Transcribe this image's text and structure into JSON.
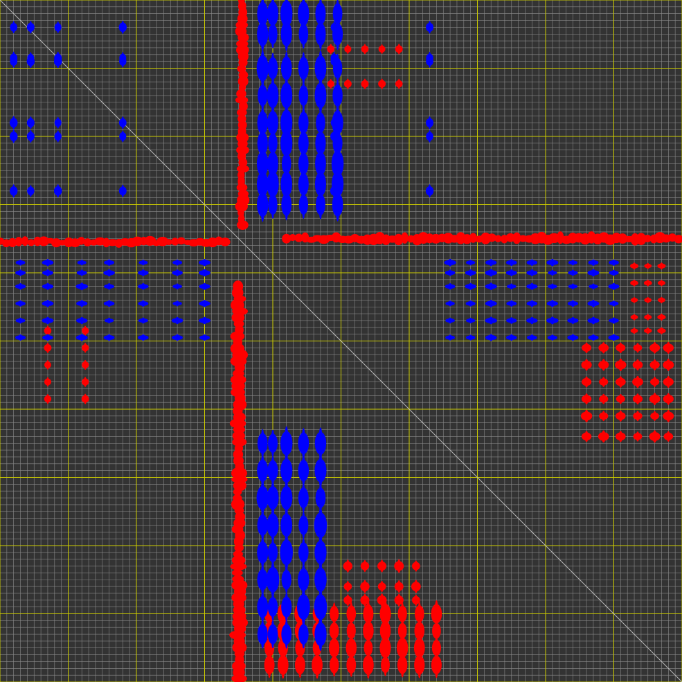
{
  "display": {
    "background_color": "#333333",
    "minor_grid_color": "#8a8a8a",
    "major_grid_color": "#cccc00",
    "diagonal_color": "#b8b8b8",
    "positive_color": "#ff0000",
    "negative_color": "#0000ff"
  },
  "chart_data": {
    "type": "heatmap",
    "title": "",
    "xlabel": "",
    "ylabel": "",
    "grid": true,
    "diagonal": true,
    "xlim": [
      0,
      1
    ],
    "ylim": [
      0,
      1
    ],
    "major_ticks": [
      0,
      0.1,
      0.2,
      0.3,
      0.4,
      0.5,
      0.6,
      0.7,
      0.8,
      0.9,
      1.0
    ],
    "minor_tick_step": 0.01,
    "series": [
      {
        "sign": "positive",
        "color": "#ff0000",
        "bands": [
          {
            "orientation": "vertical",
            "x": 0.355,
            "y_start": 0.0,
            "y_end": 0.33,
            "amplitude": 0.8
          },
          {
            "orientation": "vertical",
            "x": 0.35,
            "y_start": 0.42,
            "y_end": 0.995,
            "amplitude": 1.0
          },
          {
            "orientation": "horizontal",
            "y": 0.355,
            "x_start": 0.0,
            "x_end": 0.33,
            "amplitude": 0.8
          },
          {
            "orientation": "horizontal",
            "y": 0.35,
            "x_start": 0.42,
            "x_end": 0.995,
            "amplitude": 1.0
          }
        ],
        "peak_grids": [
          {
            "xs": [
              0.395,
              0.415,
              0.44,
              0.465,
              0.49,
              0.515,
              0.54,
              0.565,
              0.59,
              0.615,
              0.64
            ],
            "ys": [
              0.9,
              0.925,
              0.95,
              0.975
            ],
            "amplitude": 0.7,
            "vertical_stretch": 1.8
          },
          {
            "xs": [
              0.51,
              0.535,
              0.56,
              0.585,
              0.61
            ],
            "ys": [
              0.83,
              0.86,
              0.88
            ],
            "amplitude": 0.5,
            "vertical_stretch": 1.0
          },
          {
            "xs": [
              0.86,
              0.885,
              0.91,
              0.935,
              0.96,
              0.98
            ],
            "ys": [
              0.51,
              0.535,
              0.56,
              0.585,
              0.61,
              0.64
            ],
            "amplitude": 0.7,
            "vertical_stretch": 0.8
          },
          {
            "xs": [
              0.93,
              0.95,
              0.97
            ],
            "ys": [
              0.39,
              0.415,
              0.44,
              0.465,
              0.485
            ],
            "amplitude": 0.4,
            "vertical_stretch": 0.6
          },
          {
            "xs": [
              0.07,
              0.125
            ],
            "ys": [
              0.485,
              0.51,
              0.535,
              0.56,
              0.585
            ],
            "amplitude": 0.25,
            "vertical_stretch": 1.0
          },
          {
            "xs": [
              0.485,
              0.51,
              0.535,
              0.56,
              0.585
            ],
            "ys": [
              0.072,
              0.123
            ],
            "amplitude": 0.25,
            "vertical_stretch": 1.0
          }
        ]
      },
      {
        "sign": "negative",
        "color": "#0000ff",
        "bands": [],
        "peak_grids": [
          {
            "xs": [
              0.385,
              0.4,
              0.42,
              0.445,
              0.47,
              0.495
            ],
            "ys": [
              0.02,
              0.05,
              0.1,
              0.14,
              0.18,
              0.21,
              0.24,
              0.27,
              0.3
            ],
            "amplitude": 0.8,
            "vertical_stretch": 2.2
          },
          {
            "xs": [
              0.385,
              0.4,
              0.42,
              0.445,
              0.47
            ],
            "ys": [
              0.65,
              0.69,
              0.73,
              0.77,
              0.81,
              0.85,
              0.89,
              0.93
            ],
            "amplitude": 0.9,
            "vertical_stretch": 2.0
          },
          {
            "xs": [
              0.03,
              0.07,
              0.12,
              0.16,
              0.21,
              0.26,
              0.3
            ],
            "ys": [
              0.385,
              0.4,
              0.42,
              0.445,
              0.47,
              0.495
            ],
            "amplitude": 0.8,
            "vertical_stretch": 0.45
          },
          {
            "xs": [
              0.66,
              0.69,
              0.72,
              0.75,
              0.78,
              0.81,
              0.84,
              0.87,
              0.9
            ],
            "ys": [
              0.385,
              0.4,
              0.42,
              0.445,
              0.47,
              0.495
            ],
            "amplitude": 0.8,
            "vertical_stretch": 0.45
          },
          {
            "xs": [
              0.085,
              0.045,
              0.02,
              0.18,
              0.63,
              0.49
            ],
            "ys": [
              0.04,
              0.085,
              0.09,
              0.18,
              0.28,
              0.2
            ],
            "amplitude": 0.3,
            "vertical_stretch": 1.2
          }
        ]
      }
    ]
  }
}
